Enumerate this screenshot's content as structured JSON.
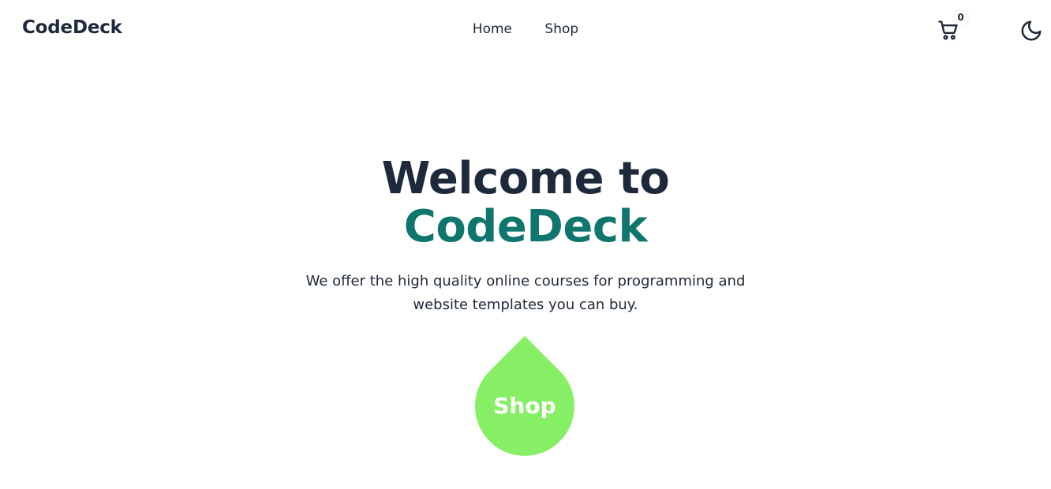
{
  "nav": {
    "brand": "CodeDeck",
    "links": [
      {
        "label": "Home"
      },
      {
        "label": "Shop"
      }
    ],
    "cart": {
      "count": "0",
      "icon": "cart-icon"
    },
    "theme_icon": "moon-icon"
  },
  "hero": {
    "title_line1": "Welcome to",
    "title_line2": "CodeDeck",
    "description": "We offer the high quality online courses for programming and website templates you can buy.",
    "cta_label": "Shop"
  },
  "colors": {
    "text_dark": "#1e293b",
    "accent_teal": "#0f766e",
    "cta_green": "#86ef66",
    "background": "#ffffff"
  }
}
